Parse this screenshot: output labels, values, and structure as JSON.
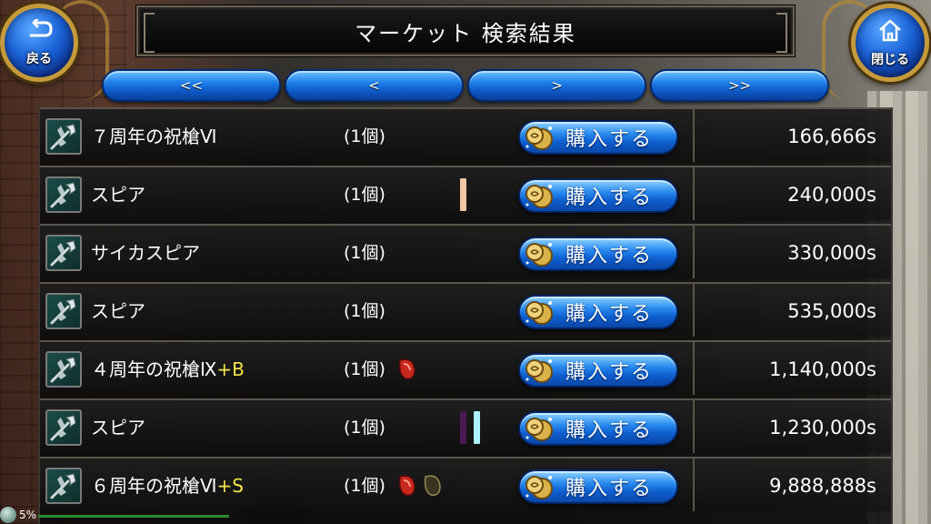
{
  "header": {
    "title": "マーケット  検索結果",
    "back_label": "戻る",
    "close_label": "閉じる"
  },
  "pager": {
    "first": "<<",
    "prev": "<",
    "next": ">",
    "last": ">>"
  },
  "buy_label": "購入する",
  "items": [
    {
      "name": "７周年の祝槍Ⅵ",
      "suffix": "",
      "qty": "(1個)",
      "price": "166,666s",
      "bars": [],
      "gems": []
    },
    {
      "name": "スピア",
      "suffix": "",
      "qty": "(1個)",
      "price": "240,000s",
      "bars": [
        "#f3c7a5"
      ],
      "gems": []
    },
    {
      "name": "サイカスピア",
      "suffix": "",
      "qty": "(1個)",
      "price": "330,000s",
      "bars": [],
      "gems": []
    },
    {
      "name": "スピア",
      "suffix": "",
      "qty": "(1個)",
      "price": "535,000s",
      "bars": [],
      "gems": []
    },
    {
      "name": "４周年の祝槍Ⅸ",
      "suffix": "+B",
      "qty": "(1個)",
      "price": "1,140,000s",
      "bars": [],
      "gems": [
        "red-gem"
      ]
    },
    {
      "name": "スピア",
      "suffix": "",
      "qty": "(1個)",
      "price": "1,230,000s",
      "bars": [
        "#4a1a55",
        "#a9f2ff"
      ],
      "gems": []
    },
    {
      "name": "６周年の祝槍Ⅵ",
      "suffix": "+S",
      "qty": "(1個)",
      "price": "9,888,888s",
      "bars": [],
      "gems": [
        "red-gem",
        "dark-gem"
      ]
    }
  ],
  "status": {
    "percent": "5%"
  },
  "colors": {
    "suffix": "#f5e44a",
    "button_blue": "#1e7ee8",
    "gold_frame": "#c59a3a"
  }
}
